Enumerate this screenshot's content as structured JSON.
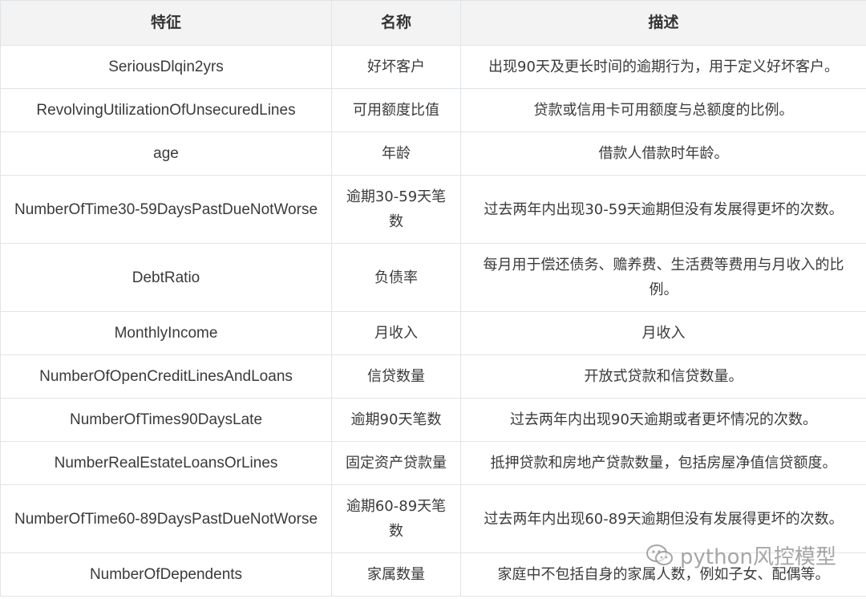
{
  "table": {
    "headers": [
      "特征",
      "名称",
      "描述"
    ],
    "rows": [
      {
        "feature": "SeriousDlqin2yrs",
        "name": "好坏客户",
        "desc": "出现90天及更长时间的逾期行为，用于定义好坏客户。"
      },
      {
        "feature": "RevolvingUtilizationOfUnsecuredLines",
        "name": "可用额度比值",
        "desc": "贷款或信用卡可用额度与总额度的比例。"
      },
      {
        "feature": "age",
        "name": "年龄",
        "desc": "借款人借款时年龄。"
      },
      {
        "feature": "NumberOfTime30-59DaysPastDueNotWorse",
        "name": "逾期30-59天笔数",
        "desc": "过去两年内出现30-59天逾期但没有发展得更坏的次数。"
      },
      {
        "feature": "DebtRatio",
        "name": "负债率",
        "desc": "每月用于偿还债务、赡养费、生活费等费用与月收入的比例。"
      },
      {
        "feature": "MonthlyIncome",
        "name": "月收入",
        "desc": "月收入"
      },
      {
        "feature": "NumberOfOpenCreditLinesAndLoans",
        "name": "信贷数量",
        "desc": "开放式贷款和信贷数量。"
      },
      {
        "feature": "NumberOfTimes90DaysLate",
        "name": "逾期90天笔数",
        "desc": "过去两年内出现90天逾期或者更坏情况的次数。"
      },
      {
        "feature": "NumberRealEstateLoansOrLines",
        "name": "固定资产贷款量",
        "desc": "抵押贷款和房地产贷款数量，包括房屋净值信贷额度。"
      },
      {
        "feature": "NumberOfTime60-89DaysPastDueNotWorse",
        "name": "逾期60-89天笔数",
        "desc": "过去两年内出现60-89天逾期但没有发展得更坏的次数。"
      },
      {
        "feature": "NumberOfDependents",
        "name": "家属数量",
        "desc": "家庭中不包括自身的家属人数，例如子女、配偶等。"
      }
    ]
  },
  "watermark": {
    "icon": "wechat-icon",
    "text": "python风控模型"
  }
}
